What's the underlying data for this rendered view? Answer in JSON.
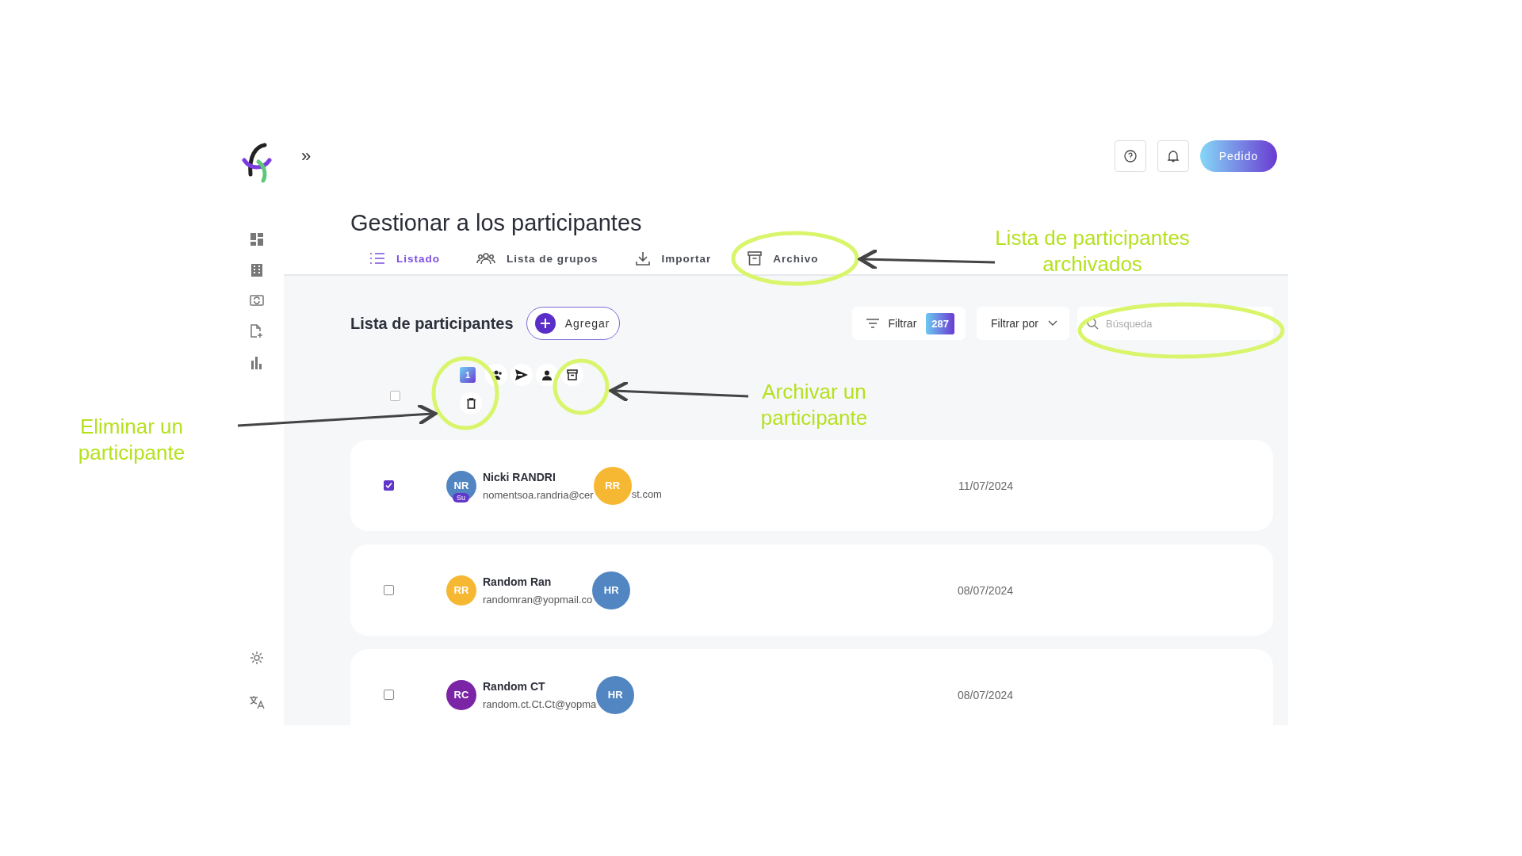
{
  "header": {
    "expand_icon": "»",
    "order_button": "Pedido"
  },
  "page_title": "Gestionar a los participantes",
  "tabs": [
    {
      "label": "Listado",
      "selected": true
    },
    {
      "label": "Lista de grupos",
      "selected": false
    },
    {
      "label": "Importar",
      "selected": false
    },
    {
      "label": "Archivo",
      "selected": false
    }
  ],
  "list_title": "Lista de participantes",
  "add_button": "Agregar",
  "filter": {
    "label": "Filtrar",
    "count": "287"
  },
  "filter_by": "Filtrar por",
  "search": {
    "placeholder": "Búsqueda"
  },
  "bulk_actions": {
    "checked": false,
    "selected_count": "1"
  },
  "participants": [
    {
      "checked": true,
      "initials": "NR",
      "color": "#5186c2",
      "tag": "Su",
      "name": "Nicki RANDRI",
      "email": "nomentsoa.randria@cer",
      "email_tail": "st.com",
      "manager": {
        "initials": "RR",
        "color": "#f6b733"
      },
      "date": "11/07/2024"
    },
    {
      "checked": false,
      "initials": "RR",
      "color": "#f6b733",
      "name": "Random Ran",
      "email": "randomran@yopmail.co",
      "manager": {
        "initials": "HR",
        "color": "#5186c2"
      },
      "date": "08/07/2024"
    },
    {
      "checked": false,
      "initials": "RC",
      "color": "#7b24a6",
      "name": "Random CT",
      "email": "random.ct.Ct.Ct@yopma",
      "manager": {
        "initials": "HR",
        "color": "#5186c2"
      },
      "date": "08/07/2024"
    }
  ],
  "annotations": [
    {
      "text": "Lista de participantes archivados"
    },
    {
      "text": "Archivar un participante"
    },
    {
      "text": "Eliminar un participante"
    }
  ]
}
